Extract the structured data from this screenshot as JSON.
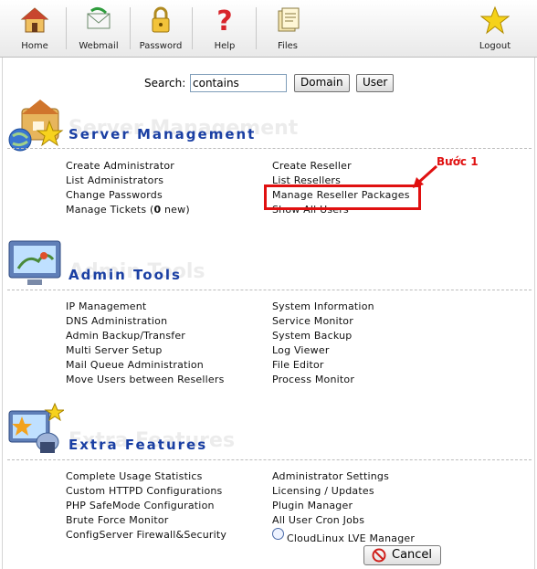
{
  "toolbar": {
    "items": [
      {
        "label": "Home",
        "icon": "house-icon"
      },
      {
        "label": "Webmail",
        "icon": "envelope-icon"
      },
      {
        "label": "Password",
        "icon": "padlock-icon"
      },
      {
        "label": "Help",
        "icon": "question-mark-icon"
      },
      {
        "label": "Files",
        "icon": "files-icon"
      },
      {
        "label": "Logout",
        "icon": "star-icon"
      }
    ]
  },
  "search": {
    "label": "Search:",
    "value": "contains",
    "domain_button": "Domain",
    "user_button": "User"
  },
  "sections": {
    "server": {
      "title": "Server Management",
      "left": [
        "Create Administrator",
        "List Administrators",
        "Change Passwords"
      ],
      "tickets_prefix": "Manage Tickets (",
      "tickets_count": "0",
      "tickets_suffix": " new)",
      "right": [
        "Create Reseller",
        "List Resellers",
        "Manage Reseller Packages",
        "Show All Users"
      ]
    },
    "admin": {
      "title": "Admin Tools",
      "left": [
        "IP Management",
        "DNS Administration",
        "Admin Backup/Transfer",
        "Multi Server Setup",
        "Mail Queue Administration",
        "Move Users between Resellers"
      ],
      "right": [
        "System Information",
        "Service Monitor",
        "System Backup",
        "Log Viewer",
        "File Editor",
        "Process Monitor"
      ]
    },
    "extra": {
      "title": "Extra Features",
      "left": [
        "Complete Usage Statistics",
        "Custom HTTPD Configurations",
        "PHP SafeMode Configuration",
        "Brute Force Monitor",
        "ConfigServer Firewall&Security"
      ],
      "right": [
        "Administrator Settings",
        "Licensing / Updates",
        "Plugin Manager",
        "All User Cron Jobs",
        "CloudLinux LVE Manager"
      ]
    }
  },
  "annotation": {
    "text": "Bước 1",
    "color": "#e01010"
  },
  "cancel": {
    "label": "Cancel"
  },
  "colors": {
    "accent": "#1a3fa3",
    "highlight": "#e01010"
  }
}
